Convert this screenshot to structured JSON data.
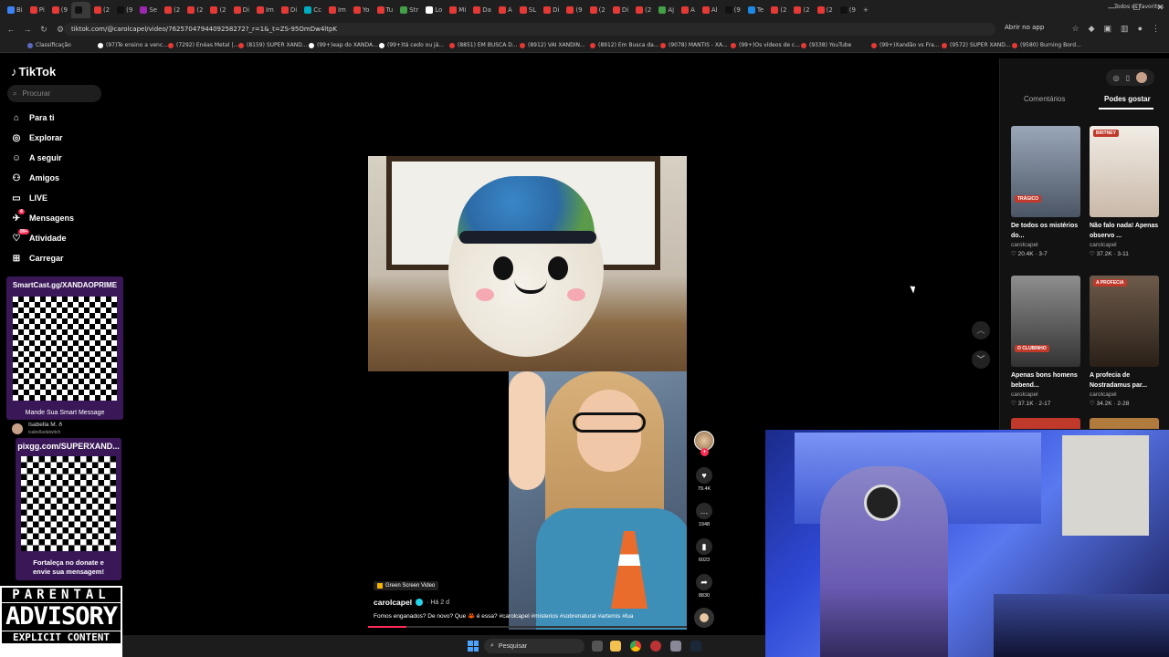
{
  "browser": {
    "url": "tiktok.com/@carolcapel/video/7625704794409258272?_r=1&_t=ZS-95OmDw4ltpK",
    "open_app": "Abrir no app",
    "all_bookmarks": "Todos os favoritos",
    "tabs": [
      "Bi",
      "Pi",
      "(9",
      "",
      "(2",
      "(9",
      "Se",
      "(2",
      "(2",
      "(2",
      "Di",
      "Im",
      "Di",
      "Cc",
      "Im",
      "Yo",
      "Tu",
      "Str",
      "Lo",
      "Mi",
      "Da",
      "A",
      "SL",
      "Di",
      "(9",
      "(2",
      "Di",
      "(2",
      "Aj",
      "A",
      "Al",
      "(9",
      "Te",
      "(2",
      "(2",
      "(2",
      "(9"
    ],
    "bookmarks": [
      "Classificação",
      "(97)Te ensino a venc...",
      "(7292) Enéas Metal |...",
      "(8159) SUPER XAND...",
      "(99+)eap do XANDÃ...",
      "(99+)tá cedo ou já...",
      "(8851) EM BUSCA D...",
      "(8912) VAI XANDIN...",
      "(8912) Em Busca da...",
      "(9078) MANTIS - XA...",
      "(99+)Os vídeos de c...",
      "(9338) YouTube",
      "(99+)Xandão vs Fra...",
      "(9572) SUPER XAND...",
      "(9580) Burning Bord..."
    ]
  },
  "sidebar": {
    "logo": "TikTok",
    "search_placeholder": "Procurar",
    "items": [
      {
        "label": "Para ti",
        "icon": "home-icon"
      },
      {
        "label": "Explorar",
        "icon": "compass-icon"
      },
      {
        "label": "A seguir",
        "icon": "following-icon"
      },
      {
        "label": "Amigos",
        "icon": "friends-icon"
      },
      {
        "label": "LIVE",
        "icon": "live-icon"
      },
      {
        "label": "Mensagens",
        "icon": "message-icon",
        "badge": "4"
      },
      {
        "label": "Atividade",
        "icon": "activity-icon",
        "badge": "99+"
      },
      {
        "label": "Carregar",
        "icon": "upload-icon"
      }
    ]
  },
  "overlay": {
    "qr1_title": "SmartCast.gg/XANDAOPRIME",
    "qr1_footer": "Mande Sua Smart Message",
    "chat_user": "Isabella M. ð",
    "chat_handle": "isabelladatwitch",
    "qr2_title": "pixgg.com/SUPERXAND...",
    "qr2_footer_line1": "Fortaleça no donate e",
    "qr2_footer_line2": "envie sua mensagem!",
    "advisory_l1": "PARENTAL",
    "advisory_l2": "ADVISORY",
    "advisory_l3": "EXPLICIT CONTENT"
  },
  "video": {
    "tag": "Green Screen Video",
    "author": "carolcapel",
    "time": "· Há 2 d",
    "caption": "Fomos enganados? De novo? Que 🦀 é essa? #carolcapel #misterios #sobrenatural #artemis #lua",
    "likes": "79.4K",
    "comments": "1948",
    "saves": "6023",
    "shares": "8830",
    "progress": 0.12
  },
  "right_panel": {
    "tab_comments": "Comentários",
    "tab_suggested": "Podes gostar",
    "cards": [
      {
        "title": "De todos os mistérios do...",
        "author": "carolcapel",
        "stats": "♡ 20.4K · 3-7",
        "thumb_label": "TRÁGICO"
      },
      {
        "title": "Não falo nada! Apenas observo ...",
        "author": "carolcapel",
        "stats": "♡ 37.2K · 3-11",
        "thumb_label": "BRITNEY"
      },
      {
        "title": "Apenas bons homens bebend...",
        "author": "carolcapel",
        "stats": "♡ 37.1K · 2-17",
        "thumb_label": "O CLUBINHO"
      },
      {
        "title": "A profecia de Nostradamus par...",
        "author": "carolcapel",
        "stats": "♡ 34.2K · 2-28",
        "thumb_label": "A PROFECIA"
      }
    ]
  },
  "taskbar": {
    "search": "Pesquisar"
  }
}
